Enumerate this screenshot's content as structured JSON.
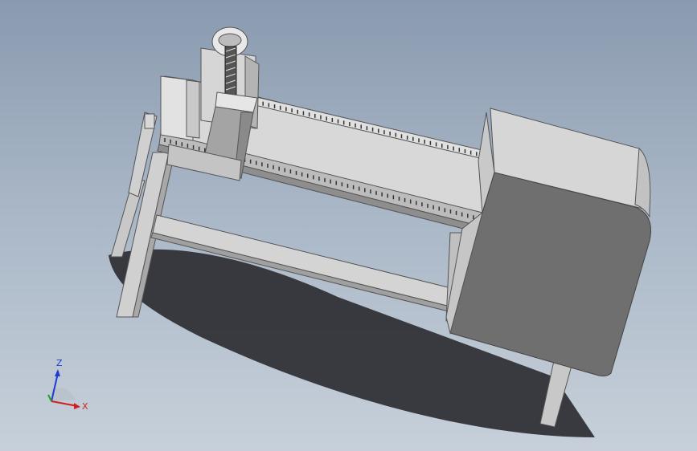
{
  "viewport": {
    "background_top": "#8a9aaf",
    "background_bottom": "#c7d0da"
  },
  "model": {
    "frame_color": "#d0d0d0",
    "shade_color": "#a8a8a8",
    "dark_color": "#6e6e6e",
    "shadow_color": "#2c2e32"
  },
  "triad": {
    "z_label": "Z",
    "x_label": "X",
    "z_color": "#1f3bd0",
    "x_color": "#d02020",
    "y_color": "#20a020"
  }
}
